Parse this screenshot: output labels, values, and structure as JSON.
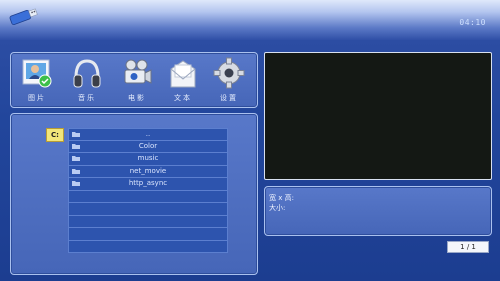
{
  "header": {
    "clock": "04:10"
  },
  "menu": {
    "items": [
      {
        "id": "photo",
        "label": "图片"
      },
      {
        "id": "music",
        "label": "音乐"
      },
      {
        "id": "movie",
        "label": "电影"
      },
      {
        "id": "text",
        "label": "文本"
      },
      {
        "id": "settings",
        "label": "设置"
      }
    ]
  },
  "browser": {
    "drive": "C:",
    "rows": [
      {
        "name": "..",
        "folder": true
      },
      {
        "name": "Color",
        "folder": true
      },
      {
        "name": "music",
        "folder": true
      },
      {
        "name": "net_movie",
        "folder": true
      },
      {
        "name": "http_async",
        "folder": true
      },
      {
        "name": "",
        "folder": false
      },
      {
        "name": "",
        "folder": false
      },
      {
        "name": "",
        "folder": false
      },
      {
        "name": "",
        "folder": false
      },
      {
        "name": "",
        "folder": false
      }
    ]
  },
  "info": {
    "resolution_label": "宽 x 高:",
    "size_label": "大小:"
  },
  "pager": {
    "text": "1 / 1"
  },
  "colors": {
    "preview_bg": "#141814",
    "drive_bg": "#f2e67a"
  }
}
